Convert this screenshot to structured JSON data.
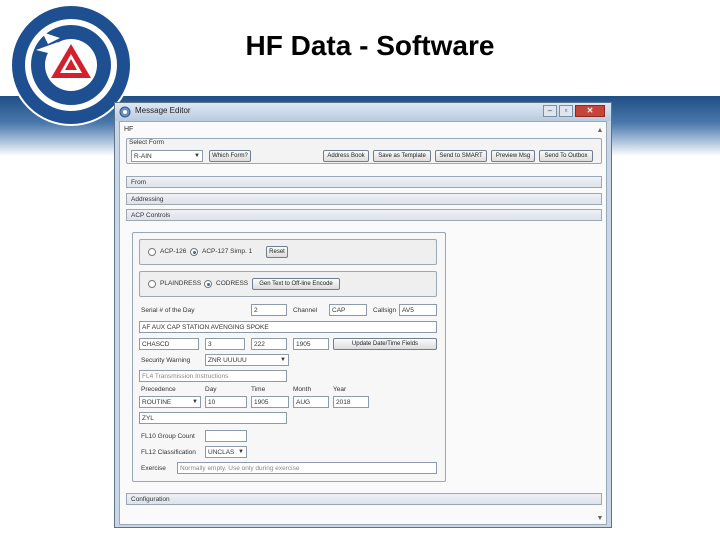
{
  "slide": {
    "title": "HF Data - Software"
  },
  "logo": {
    "text": "CIVIL AIR PATROL 1941 2018 UNITED STATES AIR FORCE AUXILIARY"
  },
  "window": {
    "title": "Message Editor",
    "controls": {
      "minimize": "‒",
      "maximize": "▫",
      "close": "✕"
    },
    "tab": "HF"
  },
  "select_form": {
    "label": "Select Form",
    "value": "R-AIN",
    "buttons": [
      "Which Form?",
      "Address Book",
      "Save as Template",
      "Send to SMART",
      "Preview Msg",
      "Send To Outbox"
    ]
  },
  "sections": {
    "from": "From",
    "addressing": "Addressing",
    "acp": "ACP Controls",
    "configuration": "Configuration"
  },
  "acp": {
    "modes": [
      {
        "label": "ACP-126",
        "selected": false
      },
      {
        "label": "ACP-127 Simp. 1",
        "selected": true
      }
    ],
    "reset": "Reset",
    "text_modes": [
      {
        "label": "PLAINDRESS",
        "selected": false
      },
      {
        "label": "CODRESS",
        "selected": true
      }
    ],
    "encode_button": "Gen Text to Off-line Encode",
    "serial_label": "Serial # of the Day",
    "serial_value": "2",
    "channel_label": "Channel",
    "channel_value": "CAP",
    "callsign_label": "Callsign",
    "callsign_value": "AV5",
    "station_text": "AF AUX CAP STATION AVENGING SPOKE",
    "row3": [
      "CHASCD",
      "3",
      "222",
      "1905"
    ],
    "update_button": "Update Date/Time Fields",
    "security_label": "Security Warning",
    "security_value": "ZNR UUUUU",
    "transmission_placeholder": "FL4 Transmission Instructions",
    "precedence_label": "Precedence",
    "day_label": "Day",
    "time_label": "Time",
    "month_label": "Month",
    "year_label": "Year",
    "precedence_value": "ROUTINE",
    "day_value": "10",
    "time_value": "1905",
    "month_value": "AUG",
    "year_value": "2018",
    "fl7_value": "ZYL",
    "group_count_label": "FL10 Group Count",
    "classification_label": "FL12 Classification",
    "classification_value": "UNCLAS",
    "exercise_label": "Exercise",
    "exercise_placeholder": "Normally empty. Use only during exercise"
  }
}
